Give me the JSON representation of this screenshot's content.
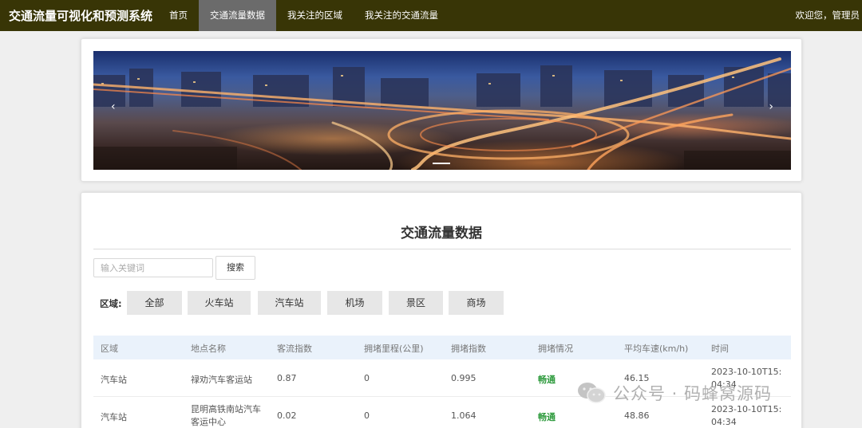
{
  "app": {
    "title": "交通流量可视化和预测系统"
  },
  "nav": {
    "items": [
      {
        "label": "首页"
      },
      {
        "label": "交通流量数据"
      },
      {
        "label": "我关注的区域"
      },
      {
        "label": "我关注的交通流量"
      }
    ],
    "active_index": 1,
    "welcome": "欢迎您，管理员"
  },
  "carousel": {
    "prev_icon": "‹",
    "next_icon": "›",
    "slides_shown": 1
  },
  "main": {
    "title": "交通流量数据",
    "search": {
      "placeholder": "输入关键词",
      "button_label": "搜索"
    },
    "region_label": "区域:",
    "filters": [
      "全部",
      "火车站",
      "汽车站",
      "机场",
      "景区",
      "商场"
    ]
  },
  "table": {
    "headers": [
      "区域",
      "地点名称",
      "客流指数",
      "拥堵里程(公里)",
      "拥堵指数",
      "拥堵情况",
      "平均车速(km/h)",
      "时间"
    ],
    "rows": [
      [
        "汽车站",
        "禄劝汽车客运站",
        "0.87",
        "0",
        "0.995",
        "畅通",
        "46.15",
        "2023-10-10T15:04:34"
      ],
      [
        "汽车站",
        "昆明高铁南站汽车客运中心",
        "0.02",
        "0",
        "1.064",
        "畅通",
        "48.86",
        "2023-10-10T15:04:34"
      ]
    ]
  },
  "colors": {
    "navbar_bg": "#383506",
    "nav_active_bg": "#6b6b6b",
    "status_good": "#2f9b3e",
    "table_header_bg": "#eaf2fb"
  },
  "watermark": {
    "text": "公众号 · 码蜂窝源码",
    "icon": "wechat-icon"
  }
}
